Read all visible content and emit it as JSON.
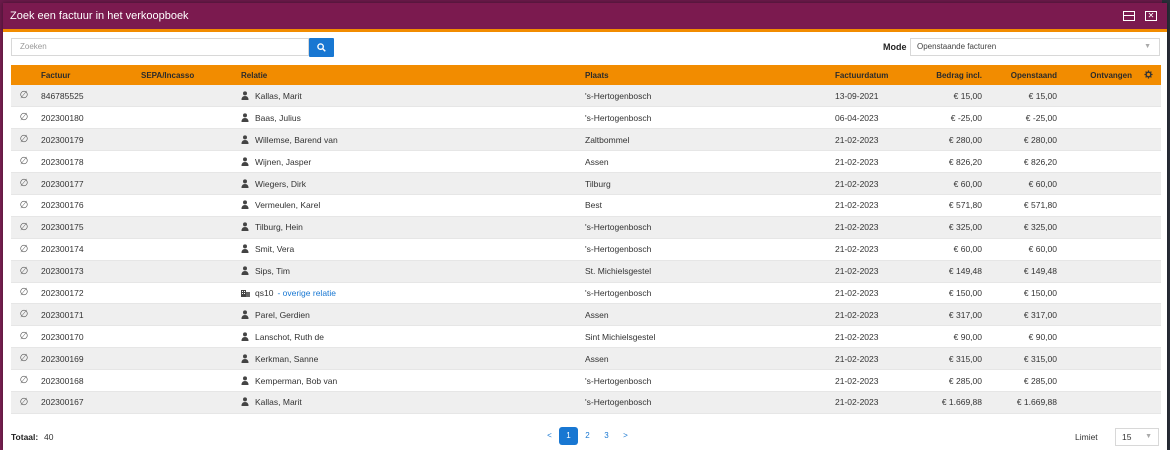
{
  "window": {
    "title": "Zoek een factuur in het verkoopboek"
  },
  "search": {
    "placeholder": "Zoeken"
  },
  "mode": {
    "label": "Mode",
    "selected": "Openstaande facturen"
  },
  "table": {
    "headers": {
      "factuur": "Factuur",
      "sepa": "SEPA/Incasso",
      "relatie": "Relatie",
      "plaats": "Plaats",
      "datum": "Factuurdatum",
      "bedrag": "Bedrag incl.",
      "openstaand": "Openstaand",
      "ontvangen": "Ontvangen"
    },
    "rows": [
      {
        "factuur": "846785525",
        "relatie": "Kallas, Marit",
        "link": "",
        "plaats": "'s-Hertogenbosch",
        "datum": "13-09-2021",
        "bedrag": "€ 15,00",
        "openstaand": "€ 15,00",
        "icon": "person-icon"
      },
      {
        "factuur": "202300180",
        "relatie": "Baas, Julius",
        "link": "",
        "plaats": "'s-Hertogenbosch",
        "datum": "06-04-2023",
        "bedrag": "€ -25,00",
        "openstaand": "€ -25,00",
        "icon": "person-icon"
      },
      {
        "factuur": "202300179",
        "relatie": "Willemse, Barend van",
        "link": "",
        "plaats": "Zaltbommel",
        "datum": "21-02-2023",
        "bedrag": "€ 280,00",
        "openstaand": "€ 280,00",
        "icon": "person-icon"
      },
      {
        "factuur": "202300178",
        "relatie": "Wijnen, Jasper",
        "link": "",
        "plaats": "Assen",
        "datum": "21-02-2023",
        "bedrag": "€ 826,20",
        "openstaand": "€ 826,20",
        "icon": "person-icon"
      },
      {
        "factuur": "202300177",
        "relatie": "Wiegers, Dirk",
        "link": "",
        "plaats": "Tilburg",
        "datum": "21-02-2023",
        "bedrag": "€ 60,00",
        "openstaand": "€ 60,00",
        "icon": "person-icon"
      },
      {
        "factuur": "202300176",
        "relatie": "Vermeulen, Karel",
        "link": "",
        "plaats": "Best",
        "datum": "21-02-2023",
        "bedrag": "€ 571,80",
        "openstaand": "€ 571,80",
        "icon": "person-icon"
      },
      {
        "factuur": "202300175",
        "relatie": "Tilburg, Hein",
        "link": "",
        "plaats": "'s-Hertogenbosch",
        "datum": "21-02-2023",
        "bedrag": "€ 325,00",
        "openstaand": "€ 325,00",
        "icon": "person-icon"
      },
      {
        "factuur": "202300174",
        "relatie": "Smit, Vera",
        "link": "",
        "plaats": "'s-Hertogenbosch",
        "datum": "21-02-2023",
        "bedrag": "€ 60,00",
        "openstaand": "€ 60,00",
        "icon": "person-icon"
      },
      {
        "factuur": "202300173",
        "relatie": "Sips, Tim",
        "link": "",
        "plaats": "St. Michielsgestel",
        "datum": "21-02-2023",
        "bedrag": "€ 149,48",
        "openstaand": "€ 149,48",
        "icon": "person-icon"
      },
      {
        "factuur": "202300172",
        "relatie": "qs10",
        "link": "- overige relatie",
        "plaats": "'s-Hertogenbosch",
        "datum": "21-02-2023",
        "bedrag": "€ 150,00",
        "openstaand": "€ 150,00",
        "icon": "company-icon"
      },
      {
        "factuur": "202300171",
        "relatie": "Parel, Gerdien",
        "link": "",
        "plaats": "Assen",
        "datum": "21-02-2023",
        "bedrag": "€ 317,00",
        "openstaand": "€ 317,00",
        "icon": "person-icon"
      },
      {
        "factuur": "202300170",
        "relatie": "Lanschot, Ruth de",
        "link": "",
        "plaats": "Sint Michielsgestel",
        "datum": "21-02-2023",
        "bedrag": "€ 90,00",
        "openstaand": "€ 90,00",
        "icon": "person-icon"
      },
      {
        "factuur": "202300169",
        "relatie": "Kerkman, Sanne",
        "link": "",
        "plaats": "Assen",
        "datum": "21-02-2023",
        "bedrag": "€ 315,00",
        "openstaand": "€ 315,00",
        "icon": "person-icon"
      },
      {
        "factuur": "202300168",
        "relatie": "Kemperman, Bob van",
        "link": "",
        "plaats": "'s-Hertogenbosch",
        "datum": "21-02-2023",
        "bedrag": "€ 285,00",
        "openstaand": "€ 285,00",
        "icon": "person-icon"
      },
      {
        "factuur": "202300167",
        "relatie": "Kallas, Marit",
        "link": "",
        "plaats": "'s-Hertogenbosch",
        "datum": "21-02-2023",
        "bedrag": "€ 1.669,88",
        "openstaand": "€ 1.669,88",
        "icon": "person-icon"
      }
    ]
  },
  "footer": {
    "total_label": "Totaal:",
    "total_value": "40",
    "pager": {
      "prev": "<",
      "pages": [
        "1",
        "2",
        "3"
      ],
      "next": ">",
      "current": "1"
    },
    "limit_label": "Limiet",
    "limit_value": "15"
  },
  "colors": {
    "titlebar": "#7b1a4f",
    "accent": "#f28c00",
    "primary": "#1877d2"
  }
}
